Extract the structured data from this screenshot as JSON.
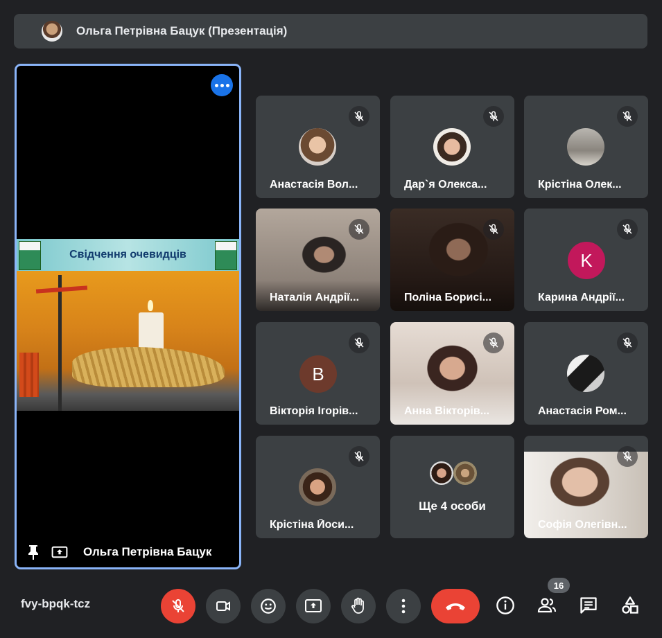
{
  "banner": {
    "title": "Ольга Петрівна Бацук (Презентація)"
  },
  "presenter": {
    "name": "Ольга Петрівна Бацук",
    "slide_title": "Свідчення очевидців"
  },
  "tiles": [
    {
      "name": "Анастасія Вол...",
      "muted": true
    },
    {
      "name": "Дар`я Олекса...",
      "muted": true
    },
    {
      "name": "Крістіна Олек...",
      "muted": true
    },
    {
      "name": "Наталія Андрії...",
      "muted": true
    },
    {
      "name": "Поліна Борисі...",
      "muted": true
    },
    {
      "name": "Карина Андрії...",
      "muted": true,
      "avatar_letter": "K",
      "avatar_color": "#c2185b"
    },
    {
      "name": "Вікторія Ігорів...",
      "muted": true,
      "avatar_letter": "B",
      "avatar_color": "#6d3a2c"
    },
    {
      "name": "Анна Вікторів...",
      "muted": true
    },
    {
      "name": "Анастасія Ром...",
      "muted": true
    },
    {
      "name": "Крістіна Йоси...",
      "muted": true
    },
    {
      "name": "Ще 4 особи"
    },
    {
      "name": "Софія Олегівн...",
      "muted": true
    }
  ],
  "bottom": {
    "meeting_code": "fvy-bpqk-tcz",
    "participants_count": "16"
  },
  "colors": {
    "accent": "#8ab4f8",
    "danger": "#ea4335",
    "tile_bg": "#3c4043",
    "bg": "#202124"
  },
  "icons": [
    "mic-off-icon",
    "camera-icon",
    "emoji-icon",
    "present-icon",
    "raise-hand-icon",
    "more-vert-icon",
    "end-call-icon",
    "info-icon",
    "people-icon",
    "chat-icon",
    "activities-icon",
    "pin-icon"
  ]
}
